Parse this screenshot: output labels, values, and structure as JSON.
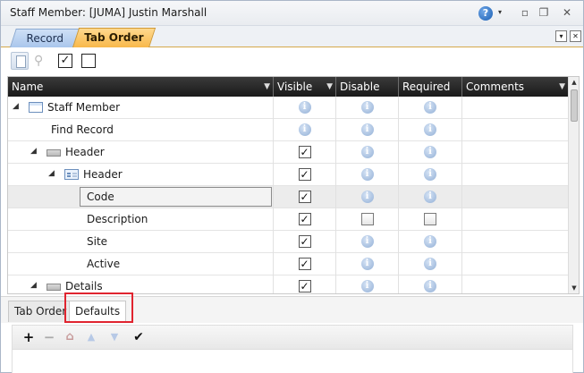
{
  "window": {
    "title": "Staff Member: [JUMA] Justin Marshall",
    "help_glyph": "?",
    "caret_glyph": "▾",
    "minimize_glyph": "▫",
    "restore_glyph": "❐",
    "close_glyph": "✕"
  },
  "tabs": {
    "record": "Record",
    "tab_order": "Tab Order",
    "dropdown_glyph": "▾",
    "close_glyph": "✕"
  },
  "toolbar": {
    "search_glyph": "⚲",
    "check_glyph": "✓"
  },
  "grid": {
    "columns": {
      "name": "Name",
      "visible": "Visible",
      "disable": "Disable",
      "required": "Required",
      "comments": "Comments"
    },
    "filter_glyph": "▼",
    "info_glyph": "i",
    "check_glyph": "✓",
    "expander_glyph": "◢",
    "rows": [
      {
        "label": "Staff Member",
        "visible": "info",
        "disable": "info",
        "required": "info"
      },
      {
        "label": "Find Record",
        "visible": "info",
        "disable": "info",
        "required": "info"
      },
      {
        "label": "Header",
        "visible": "checked",
        "disable": "info",
        "required": "info"
      },
      {
        "label": "Header",
        "visible": "checked",
        "disable": "info",
        "required": "info"
      },
      {
        "label": "Code",
        "visible": "checked",
        "disable": "info",
        "required": "info"
      },
      {
        "label": "Description",
        "visible": "checked",
        "disable": "unchecked",
        "required": "unchecked"
      },
      {
        "label": "Site",
        "visible": "checked",
        "disable": "info",
        "required": "info"
      },
      {
        "label": "Active",
        "visible": "checked",
        "disable": "info",
        "required": "info"
      },
      {
        "label": "Details",
        "visible": "checked",
        "disable": "info",
        "required": "info"
      }
    ],
    "scroll_up_glyph": "▲",
    "scroll_down_glyph": "▼"
  },
  "bottom_tabs": {
    "tab_order": "Tab Order",
    "defaults": "Defaults"
  },
  "bottom_toolbar": {
    "add_glyph": "+",
    "remove_glyph": "−",
    "home_glyph": "⌂",
    "up_glyph": "▲",
    "down_glyph": "▼",
    "ok_glyph": "✔"
  },
  "colors": {
    "active_tab": "#f8b84a",
    "inactive_tab": "#a9c6ec",
    "header_bg": "#1a1a1a",
    "highlight_box": "#e0242f"
  }
}
